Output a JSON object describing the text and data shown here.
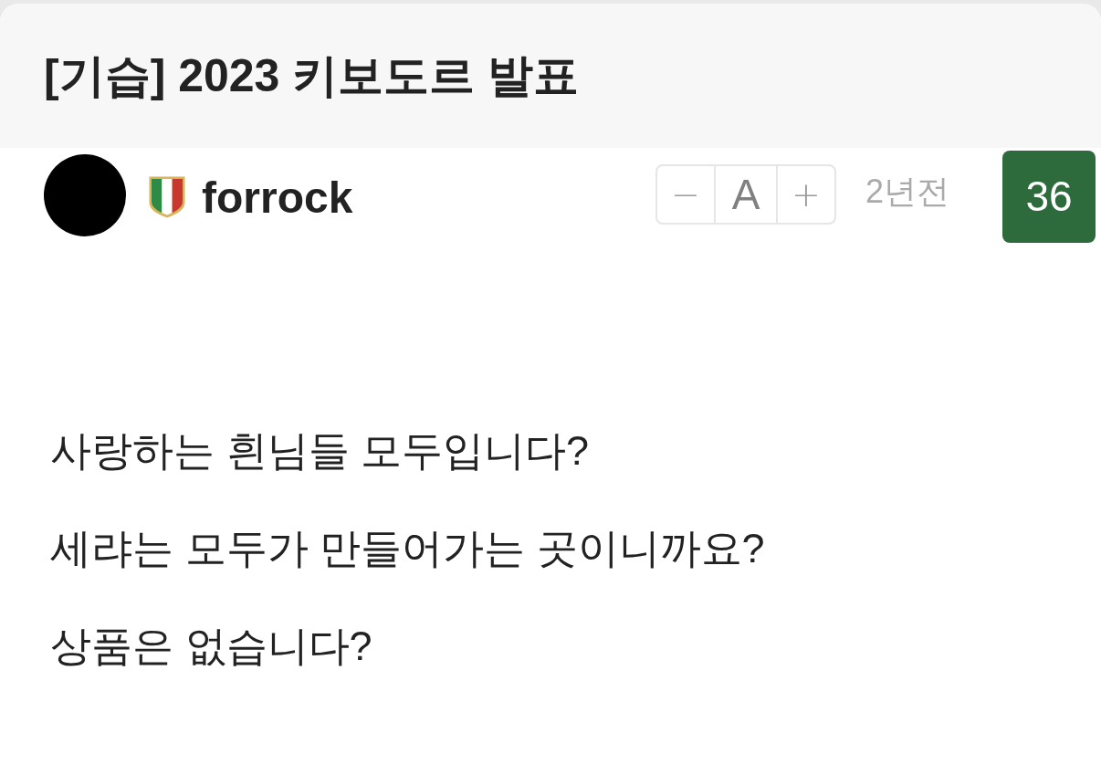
{
  "post": {
    "title": "[기습] 2023 키보도르 발표"
  },
  "author": {
    "name": "forrock"
  },
  "font_size_control": {
    "buttons": [
      {
        "kind": "decrease",
        "label": "−"
      },
      {
        "kind": "reset",
        "label": "A"
      },
      {
        "kind": "increase",
        "label": "+"
      }
    ]
  },
  "time": "2년전",
  "count_badge": "36",
  "body": {
    "paragraphs": [
      "사랑하는 흰님들 모두입니다?",
      "세랴는 모두가 만들어가는 곳이니까요?",
      "상품은 없습니다?"
    ]
  }
}
